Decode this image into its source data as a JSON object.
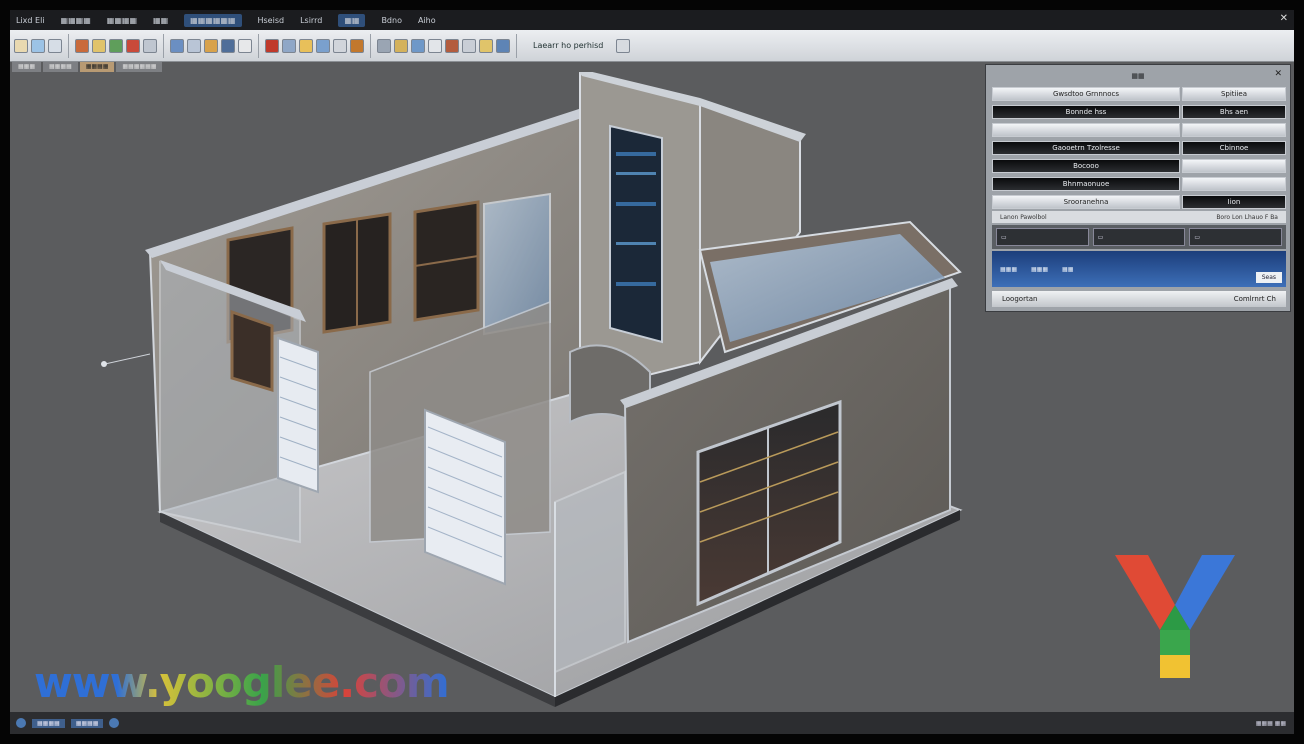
{
  "menubar": {
    "items": [
      "Lixd Eli",
      "",
      "",
      "",
      "Hseisd",
      "Lsirrd",
      "",
      "Bdno",
      "Aiho"
    ]
  },
  "ribbon": {
    "search_text": "Laearr ho perhisd"
  },
  "tabs": [
    "",
    "",
    "",
    ""
  ],
  "panel": {
    "rows": [
      {
        "left": "Gwsdtoo Grnnnocs",
        "right": "Spitiiea"
      },
      {
        "left": "Bonnde hss",
        "right": "Bhs aen"
      },
      {
        "left": "",
        "right": ""
      },
      {
        "left": "Gaooetrn Tzolresse",
        "right": "Cbinnoe"
      },
      {
        "left": "Bocooo",
        "right": ""
      },
      {
        "left": "Bhnmaonuoe",
        "right": ""
      },
      {
        "left": "Srooranehna",
        "right": "Iion"
      }
    ],
    "footer_left": "Lanon Pawolbol",
    "footer_right": "Boro  Lon  Lhauo  F  Ba",
    "blue_value": "Seas",
    "bottom_left": "Loogortan",
    "bottom_right": "Comlrnrt Ch"
  },
  "watermark": {
    "text": "www.yooglee.com"
  },
  "colors": {
    "viewport_bg": "#5b5c5e",
    "wall": "#8e8a85",
    "stucco": "#6d6a66",
    "glass": "#9cb6d1"
  }
}
